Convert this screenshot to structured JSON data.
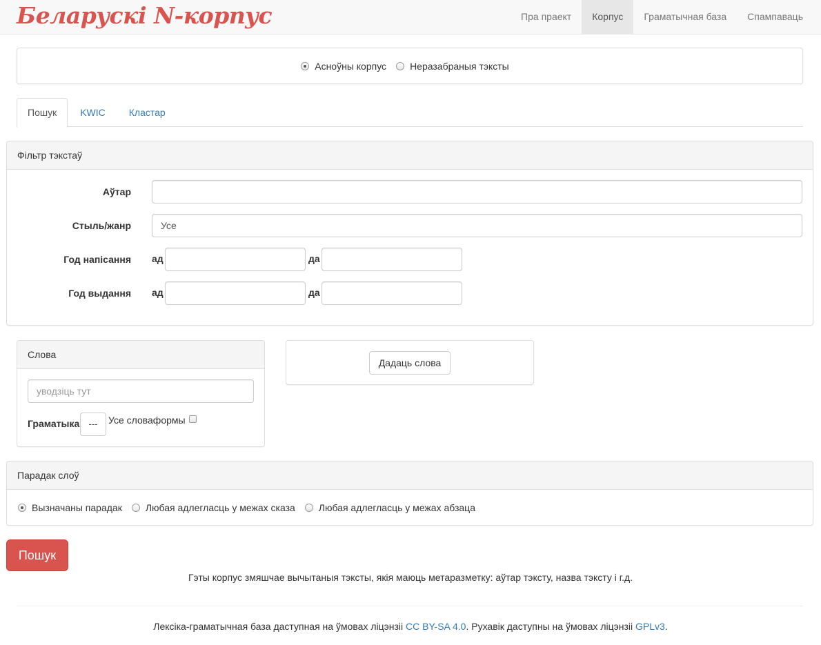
{
  "brand": "Беларускі N-корпус",
  "nav": {
    "items": [
      {
        "label": "Пра праект"
      },
      {
        "label": "Корпус"
      },
      {
        "label": "Граматычная база"
      },
      {
        "label": "Спампаваць"
      }
    ],
    "active_index": 1
  },
  "corpus_select": {
    "options": [
      {
        "label": "Асноўны корпус",
        "checked": true
      },
      {
        "label": "Неразабраныя тэксты",
        "checked": false
      }
    ]
  },
  "tabs": {
    "items": [
      {
        "label": "Пошук"
      },
      {
        "label": "KWIC"
      },
      {
        "label": "Кластар"
      }
    ],
    "active_index": 0
  },
  "filter": {
    "heading": "Фільтр тэкстаў",
    "author_label": "Аўтар",
    "author_value": "",
    "style_label": "Стыль/жанр",
    "style_value": "Усе",
    "year_written_label": "Год напісання",
    "year_published_label": "Год выдання",
    "from_label": "ад",
    "to_label": "да"
  },
  "words": {
    "heading": "Слова",
    "input_placeholder": "уводзіць тут",
    "grammar_label": "Граматыка",
    "grammar_value": "---",
    "all_forms_label": "Усе словаформы",
    "add_word_button": "Дадаць слова"
  },
  "word_order": {
    "heading": "Парадак слоў",
    "options": [
      {
        "label": "Вызначаны парадак",
        "checked": true
      },
      {
        "label": "Любая адлегласць у межах сказа",
        "checked": false
      },
      {
        "label": "Любая адлегласць у межах абзаца",
        "checked": false
      }
    ]
  },
  "search_button": "Пошук",
  "note": "Гэты корпус змяшчае вычытаныя тэксты, якія маюць метаразметку: аўтар тэксту, назва тэксту і г.д.",
  "footer": {
    "text1": "Лексіка-граматычная база даступная на ўмовах ліцэнзіі ",
    "link1": "CC BY-SA 4.0",
    "text2": ". Рухавік даступны на ўмовах ліцэнзіі ",
    "link2": "GPLv3",
    "text3": "."
  },
  "colors": {
    "brand": "#d9534f",
    "link": "#337ab7",
    "danger": "#d9534f"
  }
}
